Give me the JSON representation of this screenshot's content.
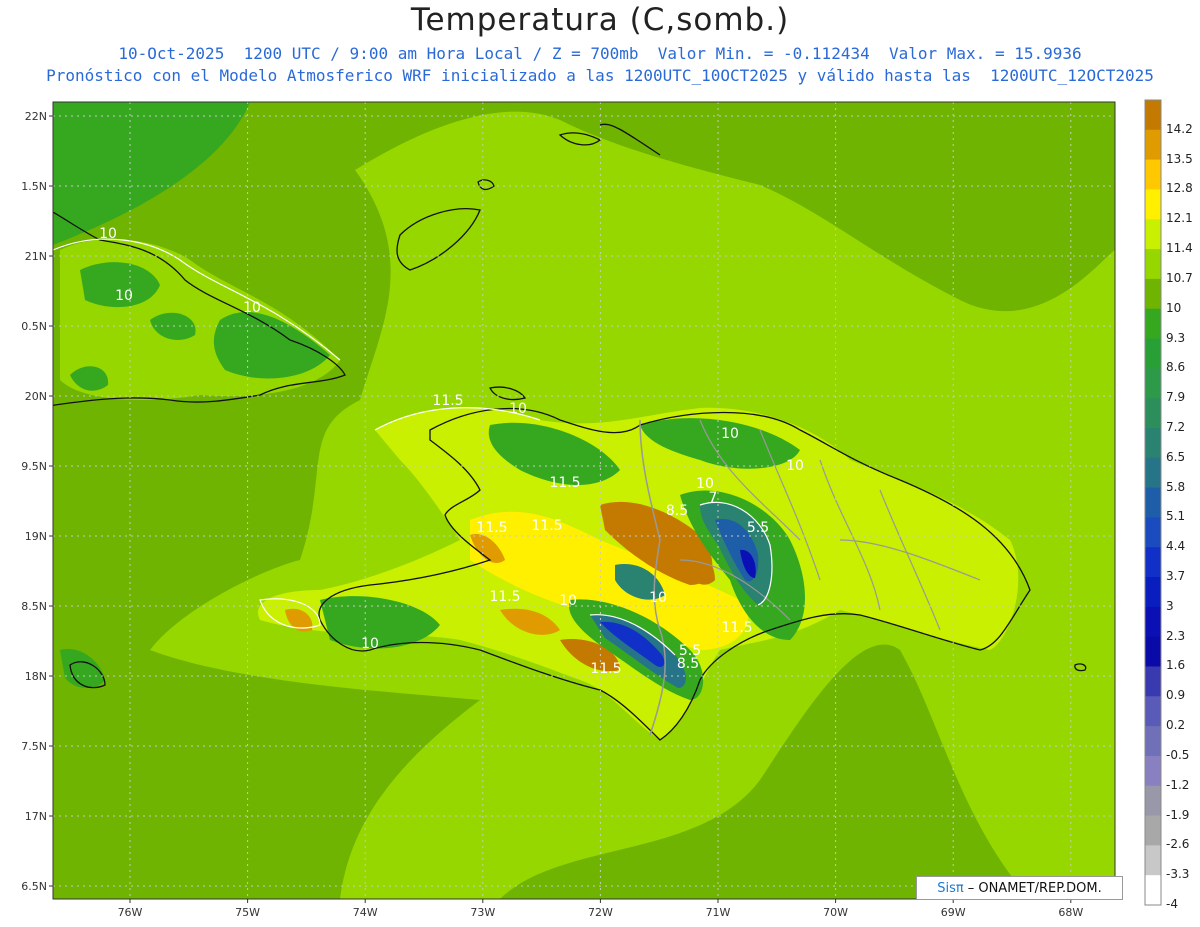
{
  "header": {
    "title": "Temperatura (C,somb.)",
    "subtitle1": "10-Oct-2025  1200 UTC / 9:00 am Hora Local / Z = 700mb  Valor Min. = -0.112434  Valor Max. = 15.9936",
    "subtitle2": "Pronóstico con el Modelo Atmosferico WRF inicializado a las 1200UTC_10OCT2025 y válido hasta las  1200UTC_12OCT2025"
  },
  "axes": {
    "lat_labels": [
      "22N",
      "1.5N",
      "21N",
      "0.5N",
      "20N",
      "9.5N",
      "19N",
      "8.5N",
      "18N",
      "7.5N",
      "17N",
      "6.5N"
    ],
    "lon_labels": [
      "76W",
      "75W",
      "74W",
      "73W",
      "72W",
      "71W",
      "70W",
      "69W",
      "68W"
    ]
  },
  "colorbar": {
    "labels": [
      "14.2",
      "13.5",
      "12.8",
      "12.1",
      "11.4",
      "10.7",
      "10",
      "9.3",
      "8.6",
      "7.9",
      "7.2",
      "6.5",
      "5.8",
      "5.1",
      "4.4",
      "3.7",
      "3",
      "2.3",
      "1.6",
      "0.9",
      "0.2",
      "-0.5",
      "-1.2",
      "-1.9",
      "-2.6",
      "-3.3",
      "-4"
    ],
    "colors": [
      "#c47a00",
      "#e09b00",
      "#ffc800",
      "#fff000",
      "#c8f000",
      "#96d700",
      "#6eb400",
      "#36a820",
      "#28a035",
      "#2c9a48",
      "#2c8e5a",
      "#2a8270",
      "#267488",
      "#1e5ea8",
      "#1a4cc0",
      "#1030c8",
      "#0a1ec0",
      "#0a10b4",
      "#0a0aa8",
      "#3a3ab0",
      "#5a5ab8",
      "#7070b8",
      "#8880c0",
      "#9898a8",
      "#a8a8a8",
      "#c8c8c8",
      "#ffffff"
    ]
  },
  "contour_labels": [
    "10",
    "10",
    "10",
    "11.5",
    "10",
    "10",
    "10",
    "11.5",
    "11.5",
    "11.5",
    "11.5",
    "10",
    "7",
    "8.5",
    "5.5",
    "11.5",
    "10",
    "10",
    "8.5",
    "11.5",
    "5.5",
    "10"
  ],
  "credit": {
    "brand": "Sisπ",
    "org": "– ONAMET/REP.DOM."
  }
}
